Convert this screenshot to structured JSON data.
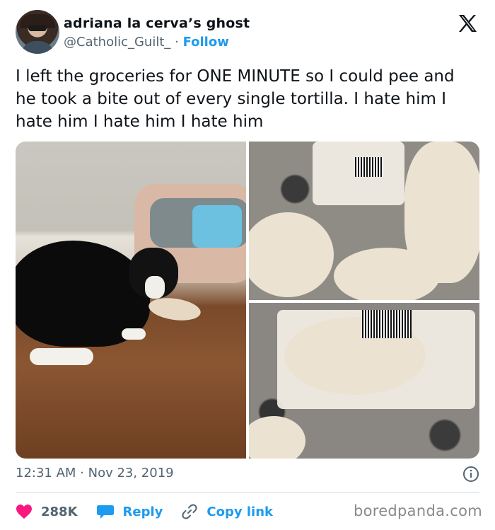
{
  "user": {
    "display_name": "adriana la cerva’s ghost",
    "handle": "@Catholic_Guilt_",
    "separator": " · ",
    "follow_label": "Follow"
  },
  "tweet": {
    "text": "I left the groceries for ONE MINUTE so I could pee and he took a bite out of every single tortilla. I hate him I hate him I hate him I hate him",
    "timestamp": "12:31 AM · Nov 23, 2019"
  },
  "actions": {
    "likes_count": "288K",
    "reply_label": "Reply",
    "copy_link_label": "Copy link"
  },
  "watermark": "boredpanda.com",
  "icons": {
    "platform": "x-logo-icon",
    "like": "heart-icon",
    "reply": "speech-bubble-icon",
    "copy": "link-icon",
    "info": "info-icon"
  },
  "colors": {
    "accent": "#1d9bf0",
    "like": "#f91880",
    "muted": "#536471",
    "text": "#0f1419"
  }
}
